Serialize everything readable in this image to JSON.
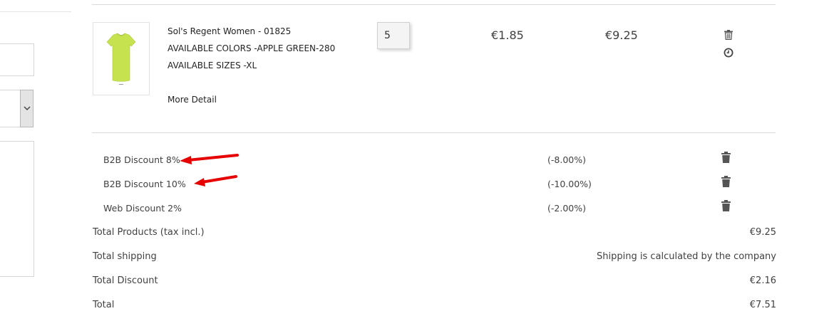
{
  "product": {
    "name": "Sol's Regent Women - 01825",
    "attr_color": "AVAILABLE COLORS -APPLE GREEN-280",
    "attr_size": "AVAILABLE SIZES -XL",
    "more_detail": "More Detail",
    "quantity": "5",
    "unit_price": "€1.85",
    "total_price": "€9.25",
    "image_icon": "t-shirt-icon",
    "image_color": "#c6e34f"
  },
  "discounts": [
    {
      "name": "B2B Discount 8%",
      "value": "(-8.00%)"
    },
    {
      "name": "B2B Discount 10%",
      "value": "(-10.00%)"
    },
    {
      "name": "Web Discount 2%",
      "value": "(-2.00%)"
    }
  ],
  "totals": [
    {
      "label": "Total Products (tax incl.)",
      "value": "€9.25"
    },
    {
      "label": "Total shipping",
      "value": "Shipping is calculated by the company"
    },
    {
      "label": "Total Discount",
      "value": "€2.16"
    },
    {
      "label": "Total",
      "value": "€7.51"
    }
  ],
  "icons": {
    "remove": "trash-icon",
    "save_later": "clock-icon",
    "annotation": "red-arrow-icon",
    "select": "chevron-down-icon"
  },
  "colors": {
    "annotation_arrow": "#e60000",
    "text": "#414141"
  }
}
